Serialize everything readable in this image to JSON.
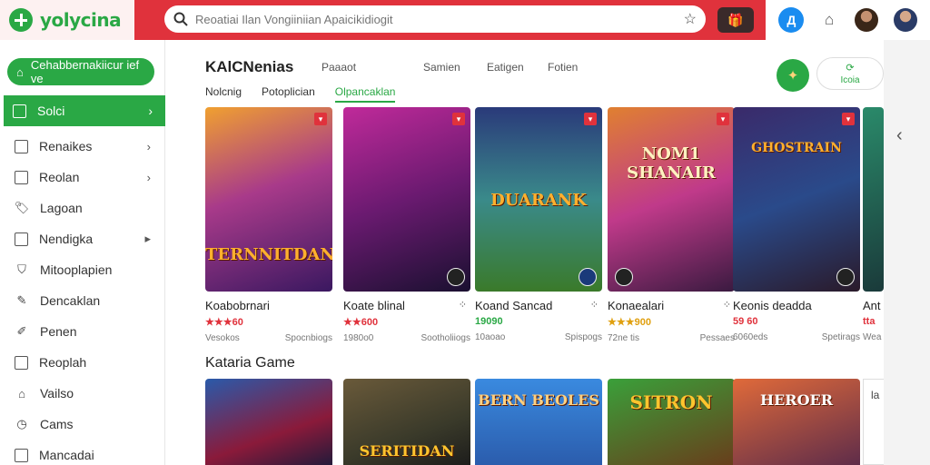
{
  "header": {
    "logo_text": "yolycina",
    "search_placeholder": "Reoatiai Ilan Vongiiniian Apaicikidiogit",
    "star_icon": "star-icon",
    "promo_icon": "gift-icon",
    "account_initial": "Д",
    "store_icon": "store-icon"
  },
  "sidebar": {
    "top_button": "Cehabbernakiicur ief ve",
    "active_item": "Solci",
    "items": [
      {
        "label": "Renaikes",
        "icon": "box-icon",
        "chevron": true
      },
      {
        "label": "Reolan",
        "icon": "box-icon",
        "chevron": true
      },
      {
        "label": "Lagoan",
        "icon": "tag-icon",
        "chevron": false
      },
      {
        "label": "Nendigka",
        "icon": "box-icon",
        "chevron": true
      },
      {
        "label": "Mitooplapien",
        "icon": "shield-icon",
        "chevron": false
      },
      {
        "label": "Dencaklan",
        "icon": "pencil-icon",
        "chevron": false
      },
      {
        "label": "Penen",
        "icon": "pen-icon",
        "chevron": false
      },
      {
        "label": "Reoplah",
        "icon": "box-icon",
        "chevron": false
      },
      {
        "label": "Vailso",
        "icon": "home-icon",
        "chevron": false
      },
      {
        "label": "Cams",
        "icon": "clock-icon",
        "chevron": false
      },
      {
        "label": "Mancadai",
        "icon": "box-icon",
        "chevron": false
      }
    ]
  },
  "main": {
    "title": "KAlCNenias",
    "links": [
      "Paaaot",
      "Samien",
      "Eatigen",
      "Fotien"
    ],
    "subtabs": [
      "Nolcnig",
      "Potoplician",
      "Olpancaklan"
    ],
    "active_subtab": 2,
    "pill_icon": "refresh-icon",
    "pill_label": "Icoia",
    "cards": [
      {
        "name": "Koabobrnari",
        "price": "★★★60",
        "price_color": "#e0323c",
        "meta_left": "Vesokos",
        "meta_right": "Spocnbiogs",
        "art": "TERNNITDAN",
        "bg": "linear-gradient(160deg,#f0a030 0%,#a83a8a 45%,#3a1860 100%)"
      },
      {
        "name": "Koate blinal",
        "price": "★★600",
        "price_color": "#e0323c",
        "meta_left": "1980o0",
        "meta_right": "Sootholiiogs",
        "art": "",
        "bg": "linear-gradient(160deg,#c02a9a 0%,#6a1a70 50%,#1a1030 100%)"
      },
      {
        "name": "Koand Sancad",
        "price": "19090",
        "price_color": "#2aa845",
        "meta_left": "10aoao",
        "meta_right": "Spispogs",
        "art": "DUARANK",
        "bg": "linear-gradient(180deg,#2a3a7a 0%,#3a8a8a 50%,#3a7a2a 100%)"
      },
      {
        "name": "Konaealari",
        "price": "★★★900",
        "price_color": "#e0a010",
        "meta_left": "72ne tis",
        "meta_right": "Pessaes",
        "art": "NOM1 SHANAIR",
        "bg": "linear-gradient(160deg,#e08030 0%,#c03a8a 50%,#3a1a40 100%)"
      },
      {
        "name": "Keonis deadda",
        "price": "59 60",
        "price_color": "#e0323c",
        "meta_left": "6060eds",
        "meta_right": "Spetirags",
        "art": "GHOSTRAIN",
        "bg": "linear-gradient(160deg,#3a2a6a 0%,#2a4a8a 50%,#2a1a2a 100%)"
      },
      {
        "name": "Ant",
        "price": "tta",
        "price_color": "#e0323c",
        "meta_left": "Wea",
        "meta_right": "",
        "art": "",
        "bg": "linear-gradient(160deg,#2a8a6a 0%,#1a3a3a 100%)"
      }
    ],
    "section_title": "Kataria Game",
    "row2": [
      {
        "art": "",
        "bg": "linear-gradient(160deg,#2a5aaa 0%,#8a1a3a 60%,#1a1a3a 100%)"
      },
      {
        "art": "SERITIDAN",
        "bg": "linear-gradient(160deg,#6a5a3a 0%,#3a3a2a 60%,#1a1a1a 100%)"
      },
      {
        "art": "BERN BEOLES",
        "bg": "linear-gradient(180deg,#3a8adf 0%,#2a5aaa 100%)"
      },
      {
        "art": "SITRON",
        "bg": "linear-gradient(160deg,#3aa03a 0%,#6a3a1a 100%)"
      },
      {
        "art": "HEROER",
        "bg": "linear-gradient(160deg,#e06a3a 0%,#5a2a4a 100%)"
      }
    ],
    "peek_label": "la"
  },
  "colors": {
    "brand_red": "#e0323c",
    "brand_green": "#2aa845",
    "link_blue": "#1a8cf0"
  }
}
